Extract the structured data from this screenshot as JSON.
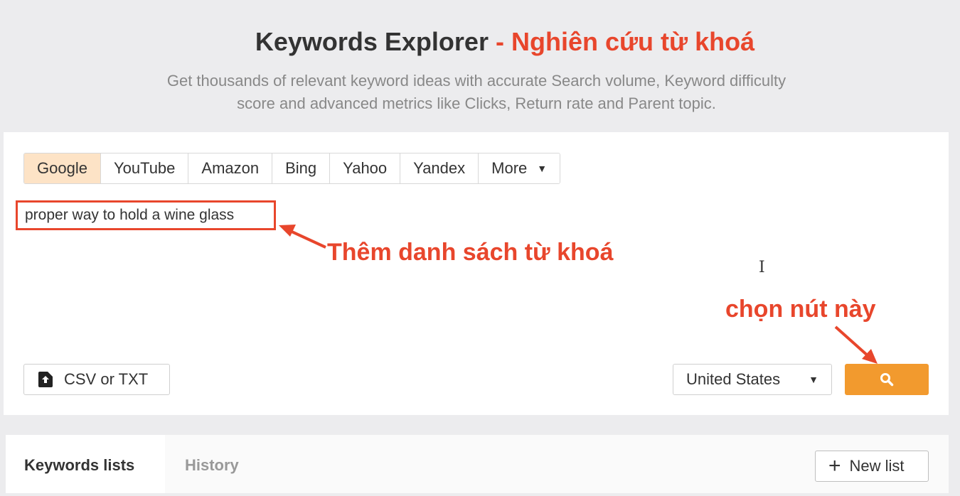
{
  "header": {
    "title": "Keywords Explorer",
    "title_annotation": "- Nghiên cứu từ khoá",
    "subtitle_line1": "Get thousands of relevant keyword ideas with accurate Search volume, Keyword difficulty",
    "subtitle_line2": "score and advanced metrics like Clicks, Return rate and Parent topic."
  },
  "search_engines": {
    "tabs": [
      {
        "label": "Google",
        "active": true
      },
      {
        "label": "YouTube"
      },
      {
        "label": "Amazon"
      },
      {
        "label": "Bing"
      },
      {
        "label": "Yahoo"
      },
      {
        "label": "Yandex"
      },
      {
        "label": "More"
      }
    ]
  },
  "keyword_input": {
    "value": "proper way to hold a wine glass"
  },
  "annotations": {
    "keywords": "Thêm danh sách từ khoá",
    "button": "chọn nút này",
    "color": "#e8462c"
  },
  "upload": {
    "label": "CSV or TXT",
    "icon": "file-upload-icon"
  },
  "country_select": {
    "selected": "United States"
  },
  "search_button": {
    "icon": "search-icon",
    "color": "#f29a2e"
  },
  "bottom_tabs": {
    "items": [
      {
        "label": "Keywords lists",
        "active": true
      },
      {
        "label": "History"
      }
    ],
    "new_list_label": "New list"
  }
}
